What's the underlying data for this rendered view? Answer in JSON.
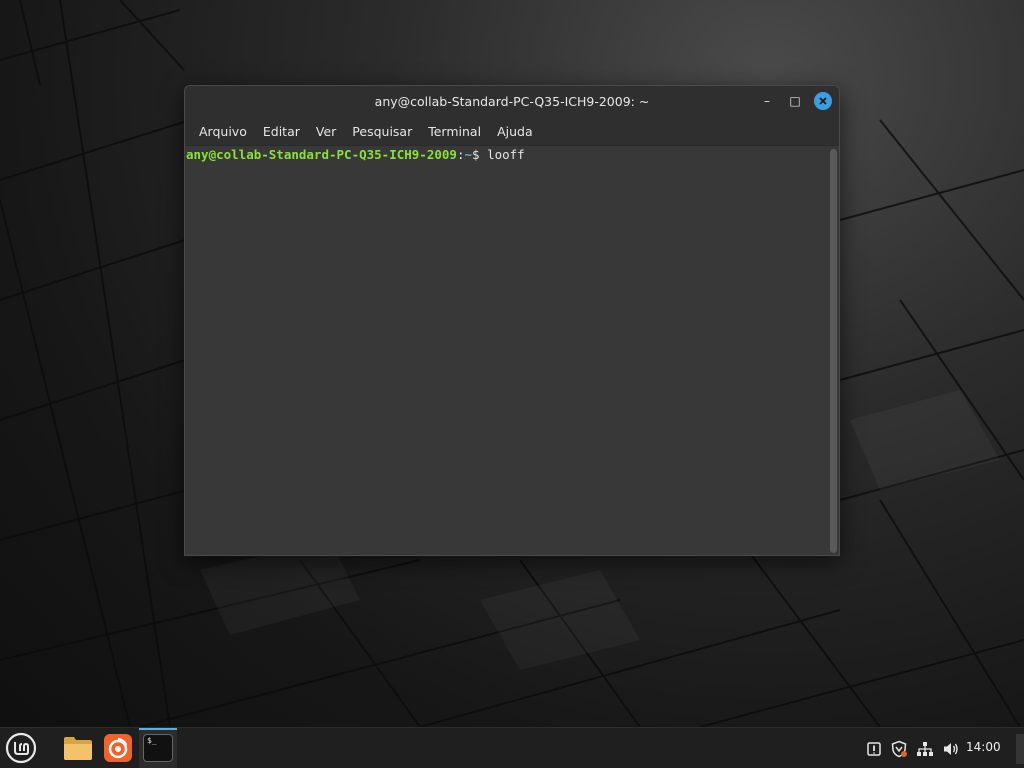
{
  "window": {
    "title": "any@collab-Standard-PC-Q35-ICH9-2009: ~",
    "controls": {
      "minimize": "–",
      "maximize": "□",
      "close": "✕"
    },
    "menu": [
      "Arquivo",
      "Editar",
      "Ver",
      "Pesquisar",
      "Terminal",
      "Ajuda"
    ]
  },
  "terminal": {
    "prompt_user": "any@collab-Standard-PC-Q35-ICH9-2009",
    "prompt_sep": ":",
    "prompt_path": "~",
    "prompt_symbol": "$ ",
    "command": "looff",
    "colors": {
      "user": "#8ae234",
      "path": "#729fcf",
      "text": "#e6e6e6",
      "background": "#383838"
    }
  },
  "taskbar": {
    "menu_icon": "linux-mint-menu-icon",
    "launchers": [
      "files-folder-icon",
      "firefox-icon",
      "terminal-icon"
    ],
    "terminal_icon_text": "$_",
    "tray": [
      "update-manager-icon",
      "shield-icon",
      "network-icon",
      "volume-icon"
    ],
    "clock": "14:00",
    "accent": "#5ab0e6"
  }
}
